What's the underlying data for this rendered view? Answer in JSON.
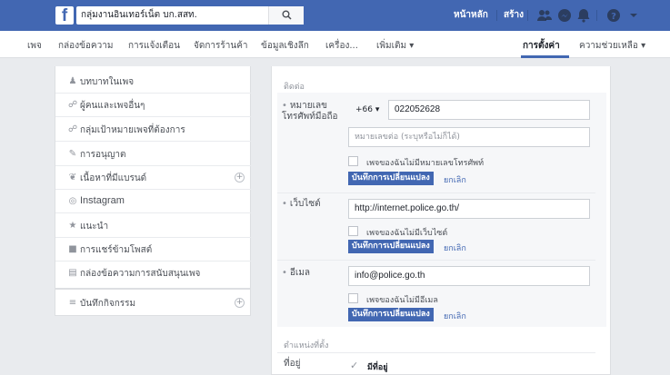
{
  "topbar": {
    "logo": "f",
    "search_value": "กลุ่มงานอินเทอร์เน็ต บก.สสท.",
    "home_label": "หน้าหลัก",
    "create_label": "สร้าง"
  },
  "pagenav": {
    "items": [
      "เพจ",
      "กล่องข้อความ",
      "การแจ้งเตือน",
      "จัดการร้านค้า",
      "ข้อมูลเชิงลึก",
      "เครื่อง..."
    ],
    "more_label": "เพิ่มเติม ▾",
    "settings_label": "การตั้งค่า",
    "help_label": "ความช่วยเหลือ ▾"
  },
  "leftmenu": {
    "items": [
      {
        "icon": "person-icon",
        "glyph": "♟",
        "label": "บทบาทในเพจ"
      },
      {
        "icon": "people-icon",
        "glyph": "☍",
        "label": "ผู้คนและเพจอื่นๆ"
      },
      {
        "icon": "target-audience-icon",
        "glyph": "☍",
        "label": "กลุ่มเป้าหมายเพจที่ต้องการ"
      },
      {
        "icon": "permission-icon",
        "glyph": "✎",
        "label": "การอนุญาต"
      },
      {
        "icon": "branded-content-icon",
        "glyph": "❦",
        "label": "เนื้อหาที่มีแบรนด์"
      },
      {
        "icon": "instagram-icon",
        "glyph": "◎",
        "label": "Instagram"
      },
      {
        "icon": "star-icon",
        "glyph": "★",
        "label": "แนะนำ"
      },
      {
        "icon": "video-icon",
        "glyph": "■",
        "label": "การแชร์ข้ามโพสต์"
      },
      {
        "icon": "inbox-icon",
        "glyph": "▤",
        "label": "กล่องข้อความการสนับสนุนเพจ"
      }
    ],
    "activity_icon": "list-icon",
    "activity_glyph": "≡",
    "activity_label": "บันทึกกิจกรรม"
  },
  "content": {
    "contact_title": "ติดต่อ",
    "phone": {
      "label": "หมายเลขโทรศัพท์มือถือ",
      "country_code": "+66 ▾",
      "value": "022052628",
      "ext_placeholder": "หมายเลขต่อ (ระบุหรือไม่ก็ได้)",
      "no_phone_label": "เพจของฉันไม่มีหมายเลขโทรศัพท์"
    },
    "website": {
      "label": "เว็บไซต์",
      "value": "http://internet.police.go.th/",
      "no_site_label": "เพจของฉันไม่มีเว็บไซต์"
    },
    "email": {
      "label": "อีเมล",
      "value": "info@police.go.th",
      "no_email_label": "เพจของฉันไม่มีอีเมล"
    },
    "save_label": "บันทึกการเปลี่ยนแปลง",
    "cancel_label": "ยกเลิก",
    "location_title": "ตำแหน่งที่ตั้ง",
    "address_label": "ที่อยู่",
    "has_address_label": "มีที่อยู่"
  },
  "colors": {
    "brand_blue": "#4267b2",
    "page_bg": "#e9ebee"
  }
}
